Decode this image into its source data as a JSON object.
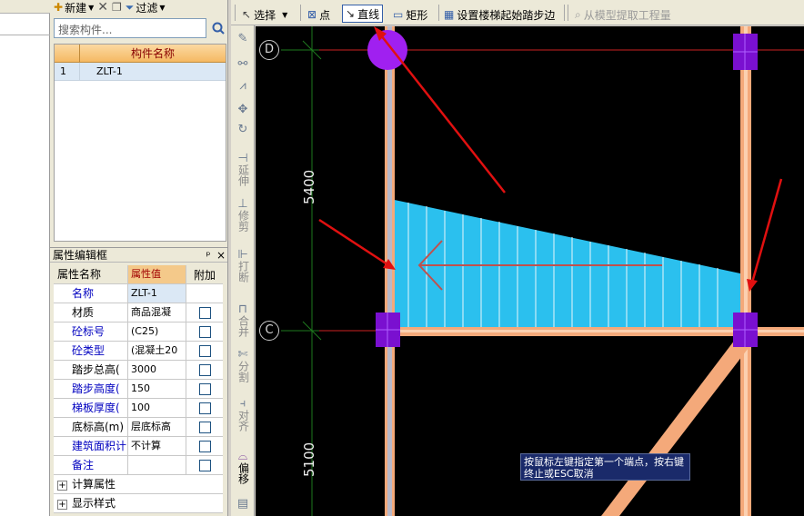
{
  "component_toolbar": {
    "new_label": "新建",
    "delete_icon": "close-icon",
    "copy_icon": "copy-icon",
    "filter_label": "过滤"
  },
  "search": {
    "placeholder": "搜索构件..."
  },
  "component_table": {
    "header": "构件名称",
    "rows": [
      {
        "index": "1",
        "name": "ZLT-1"
      }
    ]
  },
  "property_panel": {
    "title": "属性编辑框",
    "pin": "ᵖ",
    "close": "×",
    "headers": {
      "name": "属性名称",
      "value": "属性值",
      "extra": "附加"
    },
    "rows": [
      {
        "name": "名称",
        "value": "ZLT-1",
        "checkbox": false
      },
      {
        "name": "材质",
        "value": "商品混凝",
        "checkbox": true
      },
      {
        "name": "砼标号",
        "value": "(C25)",
        "checkbox": true
      },
      {
        "name": "砼类型",
        "value": "(混凝土20",
        "checkbox": true
      },
      {
        "name": "踏步总高(",
        "value": "3000",
        "checkbox": true
      },
      {
        "name": "踏步高度(",
        "value": "150",
        "checkbox": true
      },
      {
        "name": "梯板厚度(",
        "value": "100",
        "checkbox": true
      },
      {
        "name": "底标高(m)",
        "value": "层底标高",
        "checkbox": true
      },
      {
        "name": "建筑面积计",
        "value": "不计算",
        "checkbox": true
      },
      {
        "name": "备注",
        "value": "",
        "checkbox": true
      }
    ],
    "groups": [
      "计算属性",
      "显示样式"
    ]
  },
  "top_toolbar": {
    "select_label": "选择",
    "point_label": "点",
    "line_label": "直线",
    "rect_label": "矩形",
    "set_step_label": "设置楼梯起始踏步边",
    "extract_label": "从模型提取工程量"
  },
  "vertical_tools": {
    "extend": "延伸",
    "trim": "修剪",
    "break": "打断",
    "merge": "合并",
    "split": "分割",
    "align": "对齐",
    "offset": "偏移"
  },
  "canvas": {
    "axis_d": "D",
    "axis_c": "C",
    "dim_upper": "5400",
    "dim_lower": "5100",
    "status_tip": "按鼠标左键指定第一个端点，按右键终止或ESC取消"
  }
}
